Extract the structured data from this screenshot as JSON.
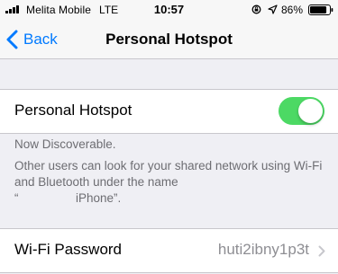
{
  "status_bar": {
    "carrier": "Melita Mobile",
    "network": "LTE",
    "time": "10:57",
    "battery_percent": "86%",
    "battery_level": 0.86,
    "signal_bars": 4
  },
  "nav": {
    "back_label": "Back",
    "title": "Personal Hotspot"
  },
  "hotspot": {
    "label": "Personal Hotspot",
    "enabled": true,
    "toggle_color": "#4cd964"
  },
  "footer": {
    "discoverable": "Now Discoverable.",
    "description_line": "Other users can look for your shared network using Wi-Fi and Bluetooth under the name",
    "name_open_quote": "“",
    "device_name_suffix": "iPhone”."
  },
  "wifi": {
    "label": "Wi-Fi Password",
    "value": "huti2ibny1p3t"
  },
  "colors": {
    "accent": "#007aff",
    "background": "#efeff4",
    "secondary_text": "#6d6d72",
    "value_text": "#8e8e93",
    "separator": "#c8c7cc"
  },
  "icons": {
    "signal": "cellular-signal-icon",
    "rotation_lock": "rotation-lock-icon",
    "location": "location-arrow-icon",
    "battery": "battery-icon",
    "back": "chevron-left-icon",
    "disclosure": "chevron-right-icon"
  }
}
